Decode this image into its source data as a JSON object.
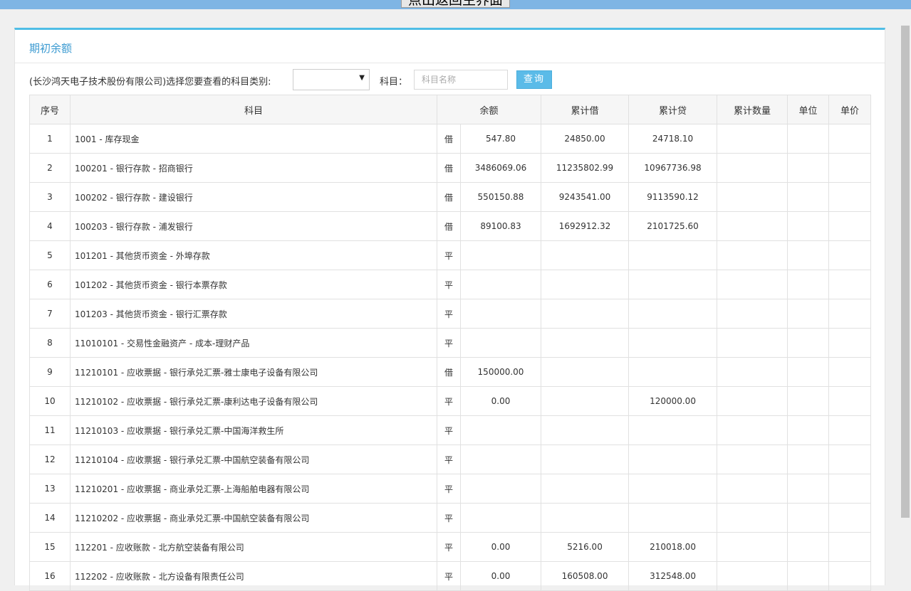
{
  "top_bar": {
    "return_label": "点出返回主界面"
  },
  "panel": {
    "title": "期初余额"
  },
  "filter": {
    "prompt": "(长沙鸿天电子技术股份有限公司)选择您要查看的科目类别:",
    "category_value": "",
    "subject_label": "科目：",
    "subject_placeholder": "科目名称",
    "query_label": "查询"
  },
  "table": {
    "headers": {
      "no": "序号",
      "subject": "科目",
      "balance": "余额",
      "cum_debit": "累计借",
      "cum_credit": "累计贷",
      "cum_qty": "累计数量",
      "unit": "单位",
      "unit_price": "单价"
    },
    "rows": [
      {
        "no": "1",
        "subject": "1001 - 库存现金",
        "dir": "借",
        "balance": "547.80",
        "debit": "24850.00",
        "credit": "24718.10",
        "qty": "",
        "unit": "",
        "price": ""
      },
      {
        "no": "2",
        "subject": "100201 - 银行存款 - 招商银行",
        "dir": "借",
        "balance": "3486069.06",
        "debit": "11235802.99",
        "credit": "10967736.98",
        "qty": "",
        "unit": "",
        "price": ""
      },
      {
        "no": "3",
        "subject": "100202 - 银行存款 - 建设银行",
        "dir": "借",
        "balance": "550150.88",
        "debit": "9243541.00",
        "credit": "9113590.12",
        "qty": "",
        "unit": "",
        "price": ""
      },
      {
        "no": "4",
        "subject": "100203 - 银行存款 - 浦发银行",
        "dir": "借",
        "balance": "89100.83",
        "debit": "1692912.32",
        "credit": "2101725.60",
        "qty": "",
        "unit": "",
        "price": ""
      },
      {
        "no": "5",
        "subject": "101201 - 其他货币资金 - 外埠存款",
        "dir": "平",
        "balance": "",
        "debit": "",
        "credit": "",
        "qty": "",
        "unit": "",
        "price": ""
      },
      {
        "no": "6",
        "subject": "101202 - 其他货币资金 - 银行本票存款",
        "dir": "平",
        "balance": "",
        "debit": "",
        "credit": "",
        "qty": "",
        "unit": "",
        "price": ""
      },
      {
        "no": "7",
        "subject": "101203 - 其他货币资金 - 银行汇票存款",
        "dir": "平",
        "balance": "",
        "debit": "",
        "credit": "",
        "qty": "",
        "unit": "",
        "price": ""
      },
      {
        "no": "8",
        "subject": "11010101 - 交易性金融资产 - 成本-理财产品",
        "dir": "平",
        "balance": "",
        "debit": "",
        "credit": "",
        "qty": "",
        "unit": "",
        "price": ""
      },
      {
        "no": "9",
        "subject": "11210101 - 应收票据 - 银行承兑汇票-雅士康电子设备有限公司",
        "dir": "借",
        "balance": "150000.00",
        "debit": "",
        "credit": "",
        "qty": "",
        "unit": "",
        "price": ""
      },
      {
        "no": "10",
        "subject": "11210102 - 应收票据 - 银行承兑汇票-康利达电子设备有限公司",
        "dir": "平",
        "balance": "0.00",
        "debit": "",
        "credit": "120000.00",
        "qty": "",
        "unit": "",
        "price": ""
      },
      {
        "no": "11",
        "subject": "11210103 - 应收票据 - 银行承兑汇票-中国海洋救生所",
        "dir": "平",
        "balance": "",
        "debit": "",
        "credit": "",
        "qty": "",
        "unit": "",
        "price": ""
      },
      {
        "no": "12",
        "subject": "11210104 - 应收票据 - 银行承兑汇票-中国航空装备有限公司",
        "dir": "平",
        "balance": "",
        "debit": "",
        "credit": "",
        "qty": "",
        "unit": "",
        "price": ""
      },
      {
        "no": "13",
        "subject": "11210201 - 应收票据 - 商业承兑汇票-上海船舶电器有限公司",
        "dir": "平",
        "balance": "",
        "debit": "",
        "credit": "",
        "qty": "",
        "unit": "",
        "price": ""
      },
      {
        "no": "14",
        "subject": "11210202 - 应收票据 - 商业承兑汇票-中国航空装备有限公司",
        "dir": "平",
        "balance": "",
        "debit": "",
        "credit": "",
        "qty": "",
        "unit": "",
        "price": ""
      },
      {
        "no": "15",
        "subject": "112201 - 应收账款 - 北方航空装备有限公司",
        "dir": "平",
        "balance": "0.00",
        "debit": "5216.00",
        "credit": "210018.00",
        "qty": "",
        "unit": "",
        "price": ""
      },
      {
        "no": "16",
        "subject": "112202 - 应收账款 - 北方设备有限责任公司",
        "dir": "平",
        "balance": "0.00",
        "debit": "160508.00",
        "credit": "312548.00",
        "qty": "",
        "unit": "",
        "price": ""
      }
    ]
  },
  "colors": {
    "accent": "#4fbde6",
    "title": "#3b9ad1",
    "top_bar": "#7fb5e4",
    "query_button": "#5bbbe8"
  }
}
